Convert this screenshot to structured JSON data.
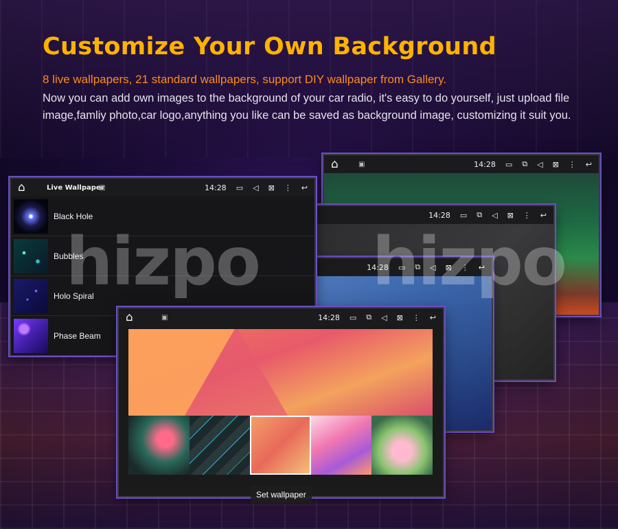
{
  "header": {
    "title": "Customize Your Own Background",
    "subtitle": "8 live wallpapers, 21 standard wallpapers, support DIY wallpaper from Gallery.",
    "description": "Now you can add own images to the background of your car radio, it's easy to do yourself, just upload file image,famliy photo,car logo,anything you like can be saved as background image, customizing it suit you."
  },
  "statusbar": {
    "time": "14:28",
    "icons": [
      "home-icon",
      "image-icon",
      "radio-icon",
      "cast-icon",
      "volume-icon",
      "close-box-icon",
      "more-icon",
      "back-icon"
    ]
  },
  "live_wallpaper": {
    "title": "Live Wallpaper",
    "items": [
      {
        "label": "Black Hole"
      },
      {
        "label": "Bubbles"
      },
      {
        "label": "Holo Spiral"
      },
      {
        "label": "Phase Beam"
      }
    ]
  },
  "wallpaper_picker": {
    "button_label": "Set wallpaper"
  },
  "watermark": {
    "text": "hizpo"
  },
  "colors": {
    "title": "#ffb300",
    "subtitle": "#ff8a1e",
    "panel_border": "#6a4fc0"
  }
}
